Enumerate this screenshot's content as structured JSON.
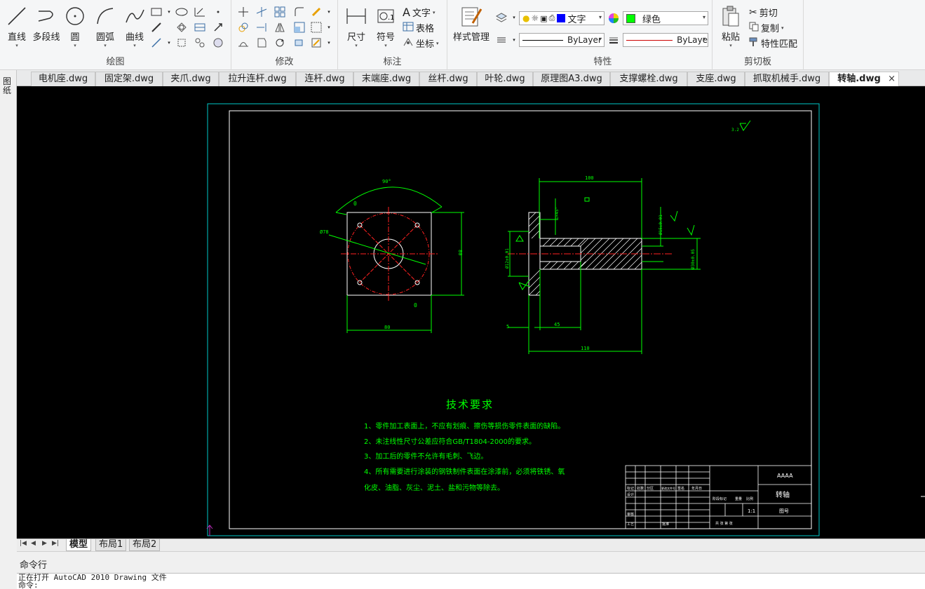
{
  "ribbon": {
    "draw": {
      "title": "绘图",
      "line": "直线",
      "polyline": "多段线",
      "circle": "圆",
      "arc": "圆弧",
      "curve": "曲线"
    },
    "modify": {
      "title": "修改"
    },
    "annotate": {
      "title": "标注",
      "dimension": "尺寸",
      "symbol": "符号",
      "text": "文字",
      "table": "表格",
      "coordinate": "坐标"
    },
    "style": {
      "label": "样式管理"
    },
    "properties": {
      "title": "特性",
      "layer_name": "文字",
      "color": "绿色",
      "color_hex": "#00ff00",
      "linetype": "ByLayer",
      "lineweight": "ByLaye"
    },
    "clipboard": {
      "title": "剪切板",
      "paste": "粘贴",
      "cut": "剪切",
      "copy": "复制",
      "match": "特性匹配"
    }
  },
  "doc_tabs": [
    "电机座.dwg",
    "固定架.dwg",
    "夹爪.dwg",
    "拉升连杆.dwg",
    "连杆.dwg",
    "末端座.dwg",
    "丝杆.dwg",
    "叶轮.dwg",
    "原理图A3.dwg",
    "支撑螺栓.dwg",
    "支座.dwg",
    "抓取机械手.dwg"
  ],
  "active_tab": "转轴.dwg",
  "left_strip": "图纸",
  "drawing": {
    "tech_title": "技术要求",
    "tech_req": [
      "1、零件加工表面上，不应有划痕、擦伤等损伤零件表面的缺陷。",
      "2、未注线性尺寸公差应符合GB/T1804-2000的要求。",
      "3、加工后的零件不允许有毛刺、飞边。",
      "4、所有需要进行涂装的钢铁制件表面在涂漆前，必须将铁锈、氧",
      "化皮、油脂、灰尘、泥土、盐和污物等除去。"
    ],
    "dims": {
      "angle": "90°",
      "dia": "Ø78",
      "left_w": "80",
      "left_h": "80",
      "top_len": "100",
      "bot_len": "110",
      "mid_len": "45",
      "small": "5",
      "d1": "Ø12±0.01",
      "d2": "Ø30±0.05",
      "d3": "Ø15±0.01",
      "g1": "1×45°"
    },
    "roughness": "3.2",
    "titleblock": {
      "name": "转轴",
      "org": "AAAA",
      "scale": "1:1",
      "drawing_no": "图号",
      "stage": "阶段标记",
      "weight": "重量",
      "ratio": "比例",
      "sheets": "共 张 第 张",
      "header_cells": [
        "标记",
        "处数",
        "分区",
        "更改文件号",
        "签名",
        "年月日"
      ],
      "row2": "设计",
      "row3": "审核",
      "row4": "工艺",
      "approve": "批准"
    }
  },
  "layout_tabs": [
    "模型",
    "布局1",
    "布局2"
  ],
  "command": {
    "header": "命令行",
    "lines": [
      "正在打开 AutoCAD 2010 Drawing 文件",
      "命令:"
    ]
  }
}
